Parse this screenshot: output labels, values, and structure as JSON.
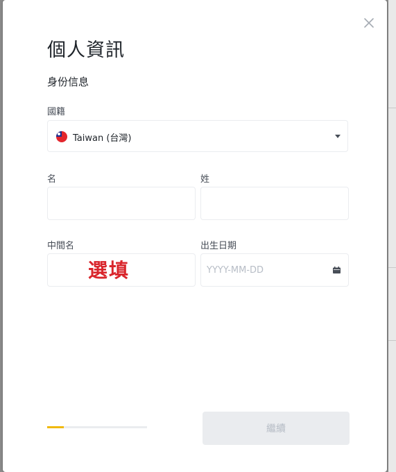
{
  "modal": {
    "title": "個人資訊",
    "section_label": "身份信息",
    "close_icon": "close-icon"
  },
  "nationality": {
    "label": "國籍",
    "selected": "Taiwan (台灣)",
    "flag_icon": "taiwan-flag-icon",
    "caret_icon": "caret-down-icon"
  },
  "first_name": {
    "label": "名",
    "value": ""
  },
  "last_name": {
    "label": "姓",
    "value": ""
  },
  "middle_name": {
    "label": "中間名",
    "value": "",
    "annotation": "選填",
    "annotation_color": "#d9262c"
  },
  "birth_date": {
    "label": "出生日期",
    "placeholder": "YYYY-MM-DD",
    "icon": "calendar-icon"
  },
  "progress": {
    "fraction": 0.17,
    "color": "#f0b90b"
  },
  "continue_button": {
    "label": "繼續"
  },
  "colors": {
    "text_primary": "#1e2329",
    "border": "#eaecef",
    "disabled_bg": "#eaecef",
    "disabled_text": "#b7bdc6"
  }
}
